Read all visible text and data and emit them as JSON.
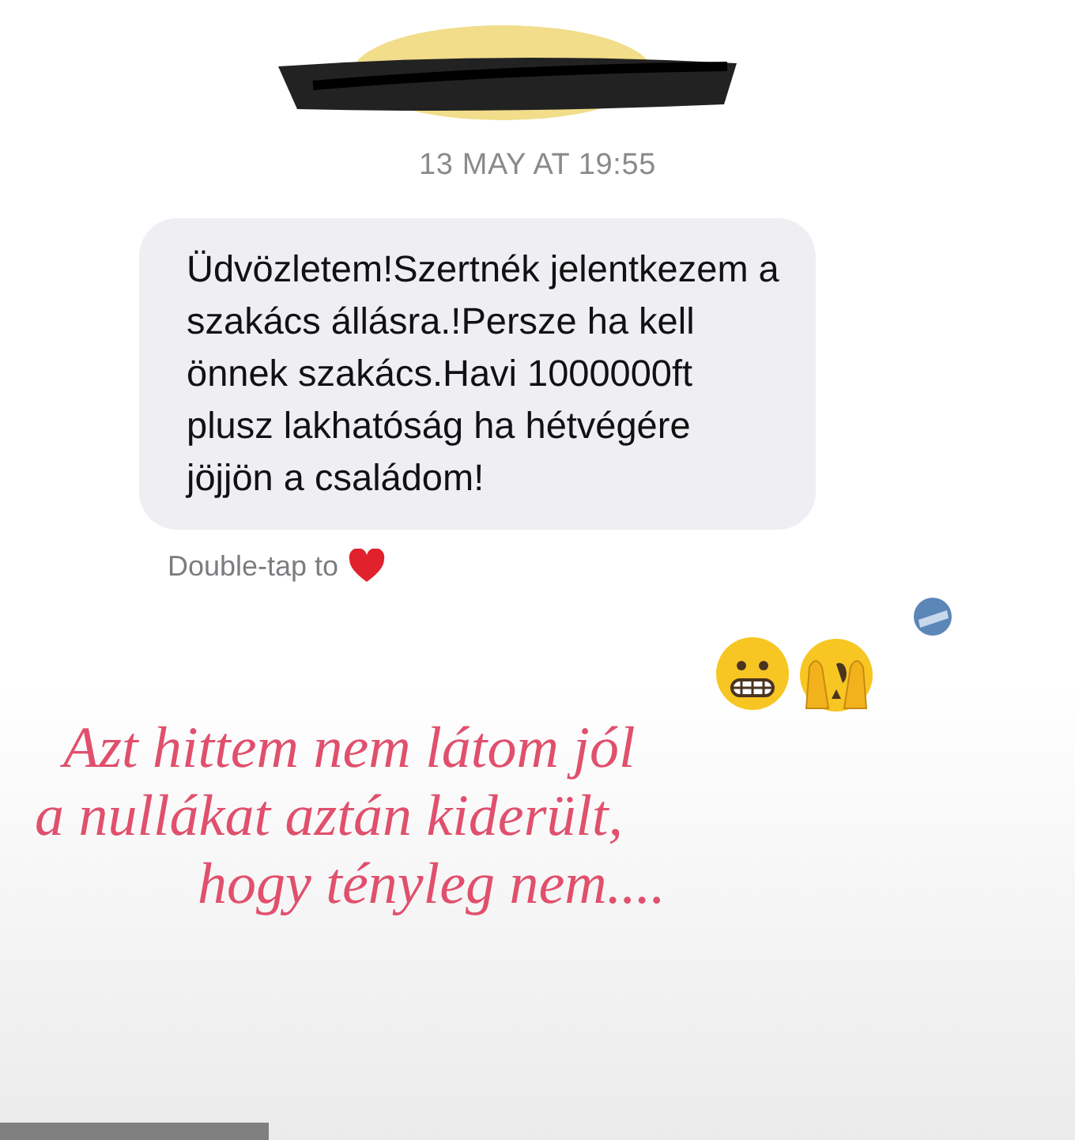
{
  "header": {
    "name_redacted": true
  },
  "timestamp": "13 MAY AT 19:55",
  "message": {
    "text": "Üdvözletem!Szertnék jelentkezem a szakács állásra.!Persze ha kell önnek szakács.Havi 1000000ft plusz lakhatóság ha hétvégére jöjjön a családom!"
  },
  "hint": "Double-tap to",
  "caption_lines": [
    "Azt hittem nem látom jól",
    "a nullákat aztán kiderült,",
    "hogy tényleg nem...."
  ]
}
